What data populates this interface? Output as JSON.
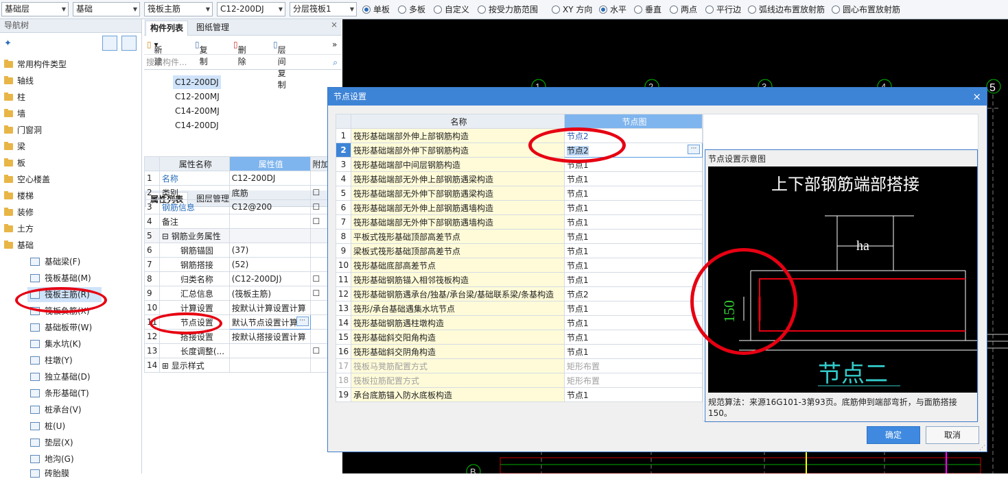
{
  "toolbar": {
    "combos": [
      "基础层",
      "基础",
      "筏板主筋",
      "C12-200DJ",
      "分层筏板1"
    ],
    "radios": [
      {
        "label": "单板",
        "checked": true
      },
      {
        "label": "多板",
        "checked": false
      },
      {
        "label": "自定义",
        "checked": false
      },
      {
        "label": "按受力筋范围",
        "checked": false
      },
      {
        "label": "XY 方向",
        "checked": false
      },
      {
        "label": "水平",
        "checked": true
      },
      {
        "label": "垂直",
        "checked": false
      },
      {
        "label": "两点",
        "checked": false
      },
      {
        "label": "平行边",
        "checked": false
      },
      {
        "label": "弧线边布置放射筋",
        "checked": false
      },
      {
        "label": "圆心布置放射筋",
        "checked": false
      }
    ]
  },
  "nav": {
    "title": "导航树",
    "folders": [
      "常用构件类型",
      "轴线",
      "柱",
      "墙",
      "门窗洞",
      "梁",
      "板",
      "空心楼盖",
      "楼梯",
      "装修",
      "土方",
      "基础"
    ],
    "children": [
      "基础梁(F)",
      "筏板基础(M)",
      "筏板主筋(R)",
      "筏板负筋(X)",
      "基础板带(W)",
      "集水坑(K)",
      "柱墩(Y)",
      "独立基础(D)",
      "条形基础(T)",
      "桩承台(V)",
      "桩(U)",
      "垫层(X)",
      "地沟(G)",
      "砖胎膜"
    ]
  },
  "comp": {
    "tab1": "构件列表",
    "tab2": "图纸管理",
    "new": "新建",
    "copy": "复制",
    "delete": "删除",
    "floorcopy": "层间复制",
    "search_placeholder": "搜索构件...",
    "items": [
      "C12-200DJ",
      "C12-200MJ",
      "C14-200MJ",
      "C14-200DJ"
    ]
  },
  "props": {
    "tab1": "属性列表",
    "tab2": "图层管理",
    "col_name": "属性名称",
    "col_value": "属性值",
    "col_extra": "附加",
    "rows": [
      {
        "no": "1",
        "name": "名称",
        "value": "C12-200DJ"
      },
      {
        "no": "2",
        "name": "类别",
        "value": "底筋"
      },
      {
        "no": "3",
        "name": "钢筋信息",
        "value": "C12@200"
      },
      {
        "no": "4",
        "name": "备注",
        "value": ""
      },
      {
        "no": "5",
        "name": "钢筋业务属性",
        "value": ""
      },
      {
        "no": "6",
        "name": "钢筋锚固",
        "value": "(37)"
      },
      {
        "no": "7",
        "name": "钢筋搭接",
        "value": "(52)"
      },
      {
        "no": "8",
        "name": "归类名称",
        "value": "(C12-200DJ)"
      },
      {
        "no": "9",
        "name": "汇总信息",
        "value": "(筏板主筋)"
      },
      {
        "no": "10",
        "name": "计算设置",
        "value": "按默认计算设置计算"
      },
      {
        "no": "11",
        "name": "节点设置",
        "value": "默认节点设置计算"
      },
      {
        "no": "12",
        "name": "搭接设置",
        "value": "按默认搭接设置计算"
      },
      {
        "no": "13",
        "name": "长度调整(...",
        "value": ""
      },
      {
        "no": "14",
        "name": "显示样式",
        "value": ""
      }
    ]
  },
  "canvas": {
    "axis_labels": [
      "1",
      "2",
      "3",
      "4",
      "5",
      "B"
    ]
  },
  "dialog": {
    "title": "节点设置",
    "col_name": "名称",
    "col_node": "节点图",
    "rows": [
      {
        "no": "1",
        "name": "筏形基础端部外伸上部钢筋构造",
        "node": "节点2"
      },
      {
        "no": "2",
        "name": "筏形基础端部外伸下部钢筋构造",
        "node": "节点2"
      },
      {
        "no": "3",
        "name": "筏形基础端部中间层钢筋构造",
        "node": "节点1"
      },
      {
        "no": "4",
        "name": "筏形基础端部无外伸上部钢筋遇梁构造",
        "node": "节点1"
      },
      {
        "no": "5",
        "name": "筏形基础端部无外伸下部钢筋遇梁构造",
        "node": "节点1"
      },
      {
        "no": "6",
        "name": "筏形基础端部无外伸上部钢筋遇墙构造",
        "node": "节点1"
      },
      {
        "no": "7",
        "name": "筏形基础端部无外伸下部钢筋遇墙构造",
        "node": "节点1"
      },
      {
        "no": "8",
        "name": "平板式筏形基础顶部高差节点",
        "node": "节点1"
      },
      {
        "no": "9",
        "name": "梁板式筏形基础顶部高差节点",
        "node": "节点1"
      },
      {
        "no": "10",
        "name": "筏形基础底部高差节点",
        "node": "节点1"
      },
      {
        "no": "11",
        "name": "筏形基础钢筋锚入相邻筏板构造",
        "node": "节点1"
      },
      {
        "no": "12",
        "name": "筏形基础钢筋遇承台/独基/承台梁/基础联系梁/条基构造",
        "node": "节点2"
      },
      {
        "no": "13",
        "name": "筏形/承台基础遇集水坑节点",
        "node": "节点1"
      },
      {
        "no": "14",
        "name": "筏形基础钢筋遇柱墩构造",
        "node": "节点1"
      },
      {
        "no": "15",
        "name": "筏形基础斜交阳角构造",
        "node": "节点1"
      },
      {
        "no": "16",
        "name": "筏形基础斜交阴角构造",
        "node": "节点1"
      },
      {
        "no": "17",
        "name": "筏板马凳筋配置方式",
        "node": "矩形布置"
      },
      {
        "no": "18",
        "name": "筏板拉筋配置方式",
        "node": "矩形布置"
      },
      {
        "no": "19",
        "name": "承台底筋锚入防水底板构造",
        "node": "节点1"
      }
    ],
    "preview_title": "节点设置示意图",
    "diagram_title": "上下部钢筋端部搭接",
    "diagram_ha": "ha",
    "diagram_dim": "150",
    "diagram_caption": "节点二",
    "rule_text": "规范算法：来源16G101-3第93页。底筋伸到端部弯折，与面筋搭接150。",
    "ok": "确定",
    "cancel": "取消"
  }
}
